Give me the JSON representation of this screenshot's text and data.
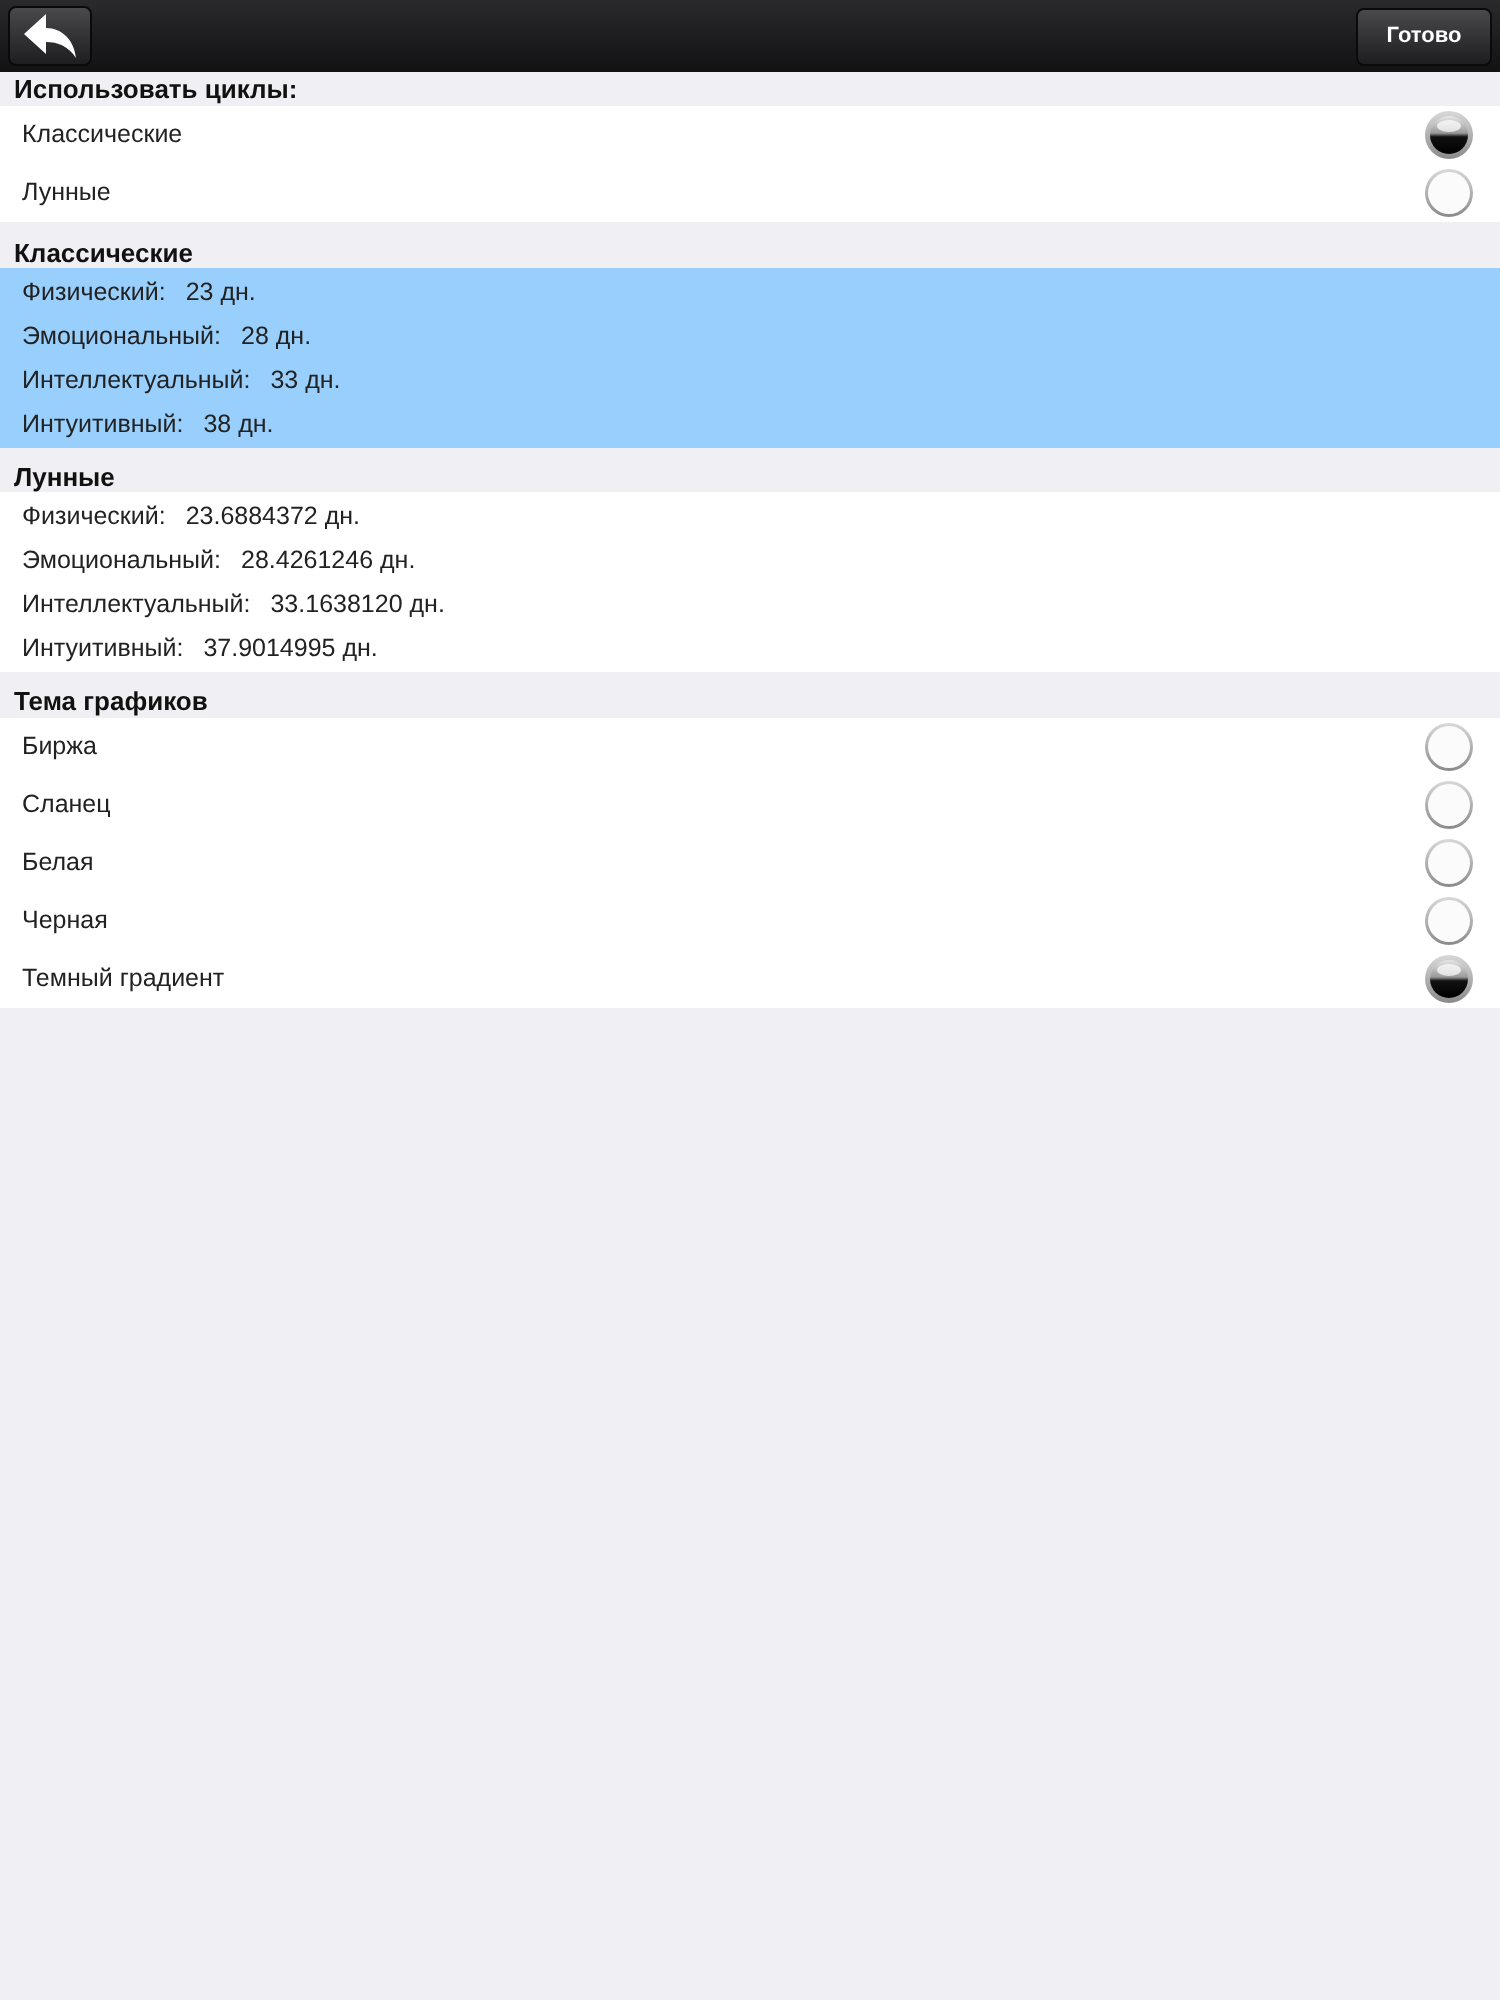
{
  "nav": {
    "done_button": "Готово"
  },
  "sections": [
    {
      "kind": "radio",
      "title": "Использовать циклы:",
      "items": [
        {
          "label": "Классические",
          "selected": true
        },
        {
          "label": "Лунные",
          "selected": false
        }
      ]
    },
    {
      "kind": "cycles",
      "title": "Классические",
      "selected": true,
      "items": [
        {
          "label": "Физический:",
          "value": "23 дн."
        },
        {
          "label": "Эмоциональный:",
          "value": "28 дн."
        },
        {
          "label": "Интеллектуальный:",
          "value": "33 дн."
        },
        {
          "label": "Интуитивный:",
          "value": "38 дн."
        }
      ]
    },
    {
      "kind": "cycles",
      "title": "Лунные",
      "selected": false,
      "items": [
        {
          "label": "Физический:",
          "value": "23.6884372 дн."
        },
        {
          "label": "Эмоциональный:",
          "value": "28.4261246 дн."
        },
        {
          "label": "Интеллектуальный:",
          "value": "33.1638120 дн."
        },
        {
          "label": "Интуитивный:",
          "value": "37.9014995 дн."
        }
      ]
    },
    {
      "kind": "radio",
      "title": "Тема графиков",
      "items": [
        {
          "label": "Биржа",
          "selected": false
        },
        {
          "label": "Сланец",
          "selected": false
        },
        {
          "label": "Белая",
          "selected": false
        },
        {
          "label": "Черная",
          "selected": false
        },
        {
          "label": "Темный градиент",
          "selected": true
        }
      ]
    }
  ]
}
